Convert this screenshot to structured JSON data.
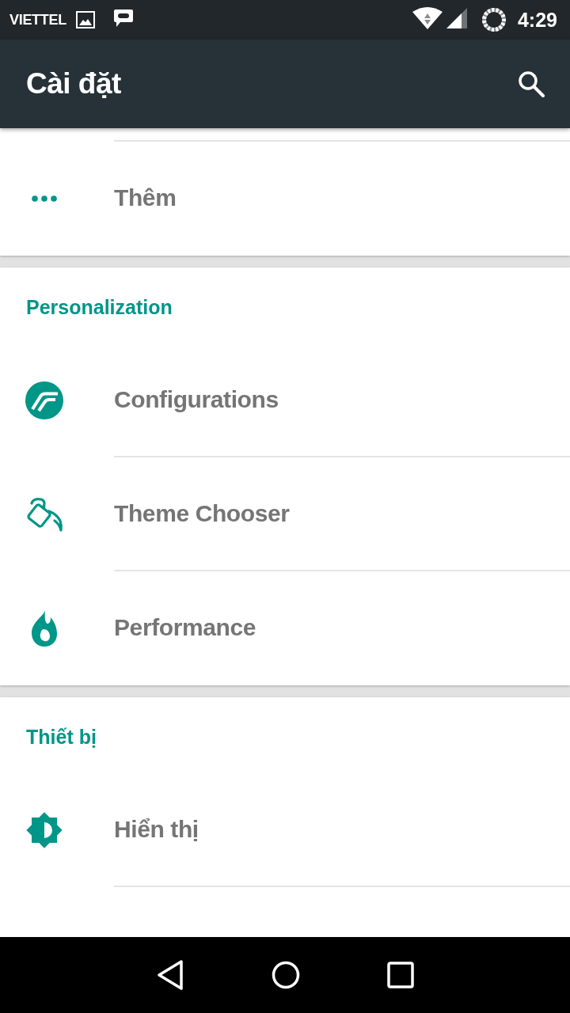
{
  "status_bar": {
    "carrier": "VIETTEL",
    "time": "4:29"
  },
  "app_bar": {
    "title": "Cài đặt"
  },
  "sections": [
    {
      "items": [
        {
          "label": "Thêm"
        }
      ]
    },
    {
      "header": "Personalization",
      "items": [
        {
          "label": "Configurations"
        },
        {
          "label": "Theme Chooser"
        },
        {
          "label": "Performance"
        }
      ]
    },
    {
      "header": "Thiết bị",
      "items": [
        {
          "label": "Hiển thị"
        }
      ]
    }
  ]
}
